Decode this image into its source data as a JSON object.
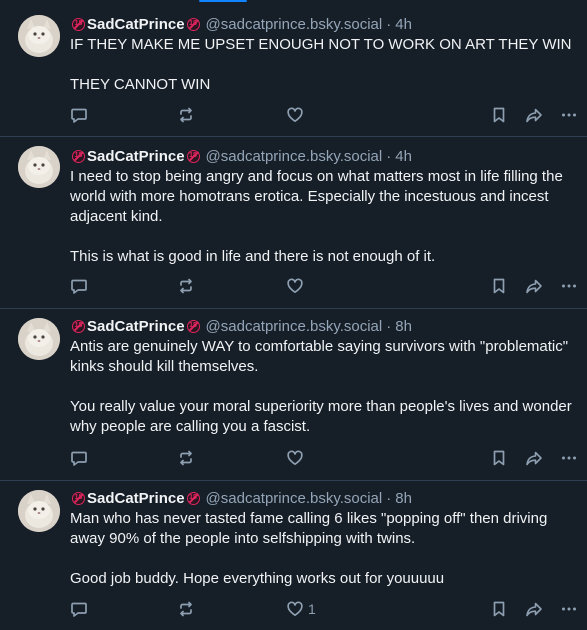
{
  "posts": [
    {
      "display_name": "SadCatPrince",
      "badge_symbol": "18",
      "handle": "@sadcatprince.bsky.social",
      "separator": "·",
      "time": "4h",
      "paragraphs": [
        "IF THEY MAKE ME UPSET ENOUGH NOT TO WORK ON ART THEY WIN",
        "THEY CANNOT WIN"
      ],
      "like_count": ""
    },
    {
      "display_name": "SadCatPrince",
      "badge_symbol": "18",
      "handle": "@sadcatprince.bsky.social",
      "separator": "·",
      "time": "4h",
      "paragraphs": [
        "I need to stop being angry and focus on what matters most in life filling the world with more homotrans erotica. Especially the incestuous and incest adjacent kind.",
        "This is what is good in life and there is not enough of it."
      ],
      "like_count": ""
    },
    {
      "display_name": "SadCatPrince",
      "badge_symbol": "18",
      "handle": "@sadcatprince.bsky.social",
      "separator": "·",
      "time": "8h",
      "paragraphs": [
        "Antis are genuinely WAY to comfortable saying survivors with \"problematic\" kinks should kill themselves.",
        "You really value your moral superiority more than people's lives and wonder why people are calling you a fascist."
      ],
      "like_count": ""
    },
    {
      "display_name": "SadCatPrince",
      "badge_symbol": "18",
      "handle": "@sadcatprince.bsky.social",
      "separator": "·",
      "time": "8h",
      "paragraphs": [
        "Man who has never tasted fame calling 6 likes \"popping off\" then driving away 90% of the people into selfshipping with twins.",
        "Good job buddy. Hope everything works out for youuuuu"
      ],
      "like_count": "1"
    }
  ],
  "icons": {
    "avatar": "cat-avatar",
    "badge": "adult-content-badge",
    "reply": "reply-icon",
    "repost": "repost-icon",
    "like": "heart-icon",
    "bookmark": "bookmark-icon",
    "share": "share-icon",
    "more": "more-options-icon"
  },
  "colors": {
    "background": "#161e27",
    "divider": "#2e4052",
    "text": "#f1f3f5",
    "muted": "#93a5b7",
    "accent": "#1083fe",
    "badge": "#e0245e"
  }
}
